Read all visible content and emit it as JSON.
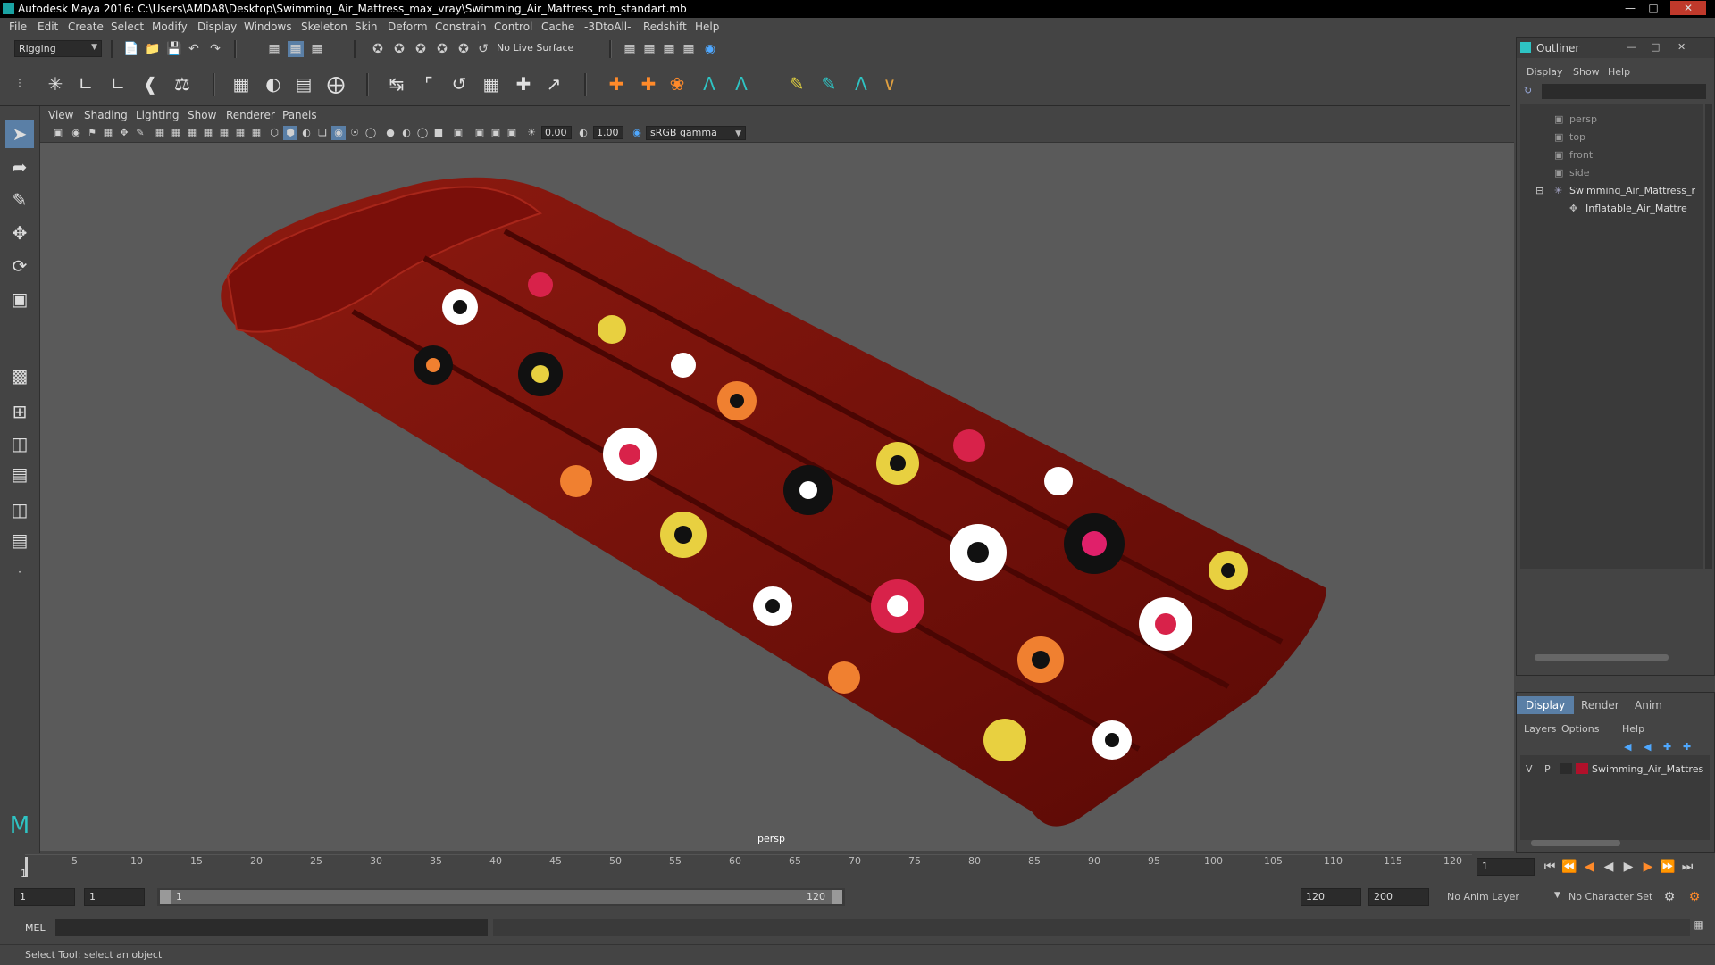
{
  "window": {
    "title": "Autodesk Maya 2016: C:\\Users\\AMDA8\\Desktop\\Swimming_Air_Mattress_max_vray\\Swimming_Air_Mattress_mb_standart.mb",
    "minimize_icon": "minimize-icon",
    "maximize_icon": "maximize-icon",
    "close_icon": "close-icon"
  },
  "menubar": {
    "items": [
      "File",
      "Edit",
      "Create",
      "Select",
      "Modify",
      "Display",
      "Windows",
      "Skeleton",
      "Skin",
      "Deform",
      "Constrain",
      "Control",
      "Cache",
      "-3DtoAll-",
      "Redshift",
      "Help"
    ]
  },
  "statusline": {
    "menuset": "Rigging",
    "live_surface": "No Live Surface"
  },
  "viewport": {
    "menu": [
      "View",
      "Shading",
      "Lighting",
      "Show",
      "Renderer",
      "Panels"
    ],
    "near_value": "0.00",
    "far_value": "1.00",
    "color_space": "sRGB gamma",
    "camera_label": "persp",
    "accent_color": "#2a6f9f",
    "mattress_color": "#7a0f0a"
  },
  "outliner": {
    "title": "Outliner",
    "menu": [
      "Display",
      "Show",
      "Help"
    ],
    "items": [
      {
        "label": "persp",
        "icon": "camera-icon"
      },
      {
        "label": "top",
        "icon": "camera-icon"
      },
      {
        "label": "front",
        "icon": "camera-icon"
      },
      {
        "label": "side",
        "icon": "camera-icon"
      },
      {
        "label": "Swimming_Air_Mattress_r",
        "icon": "group-icon"
      },
      {
        "label": "Inflatable_Air_Mattre",
        "icon": "mesh-icon"
      }
    ]
  },
  "layer_editor": {
    "tabs": [
      "Display",
      "Render",
      "Anim"
    ],
    "menu": [
      "Layers",
      "Options",
      "Help"
    ],
    "layer": {
      "v": "V",
      "p": "P",
      "name": "Swimming_Air_Mattres",
      "color": "#b0102a"
    }
  },
  "timeline": {
    "ticks": [
      "5",
      "10",
      "15",
      "20",
      "25",
      "30",
      "35",
      "40",
      "45",
      "50",
      "55",
      "60",
      "65",
      "70",
      "75",
      "80",
      "85",
      "90",
      "95",
      "100",
      "105",
      "110",
      "115",
      "120"
    ],
    "start_marker": "1",
    "current_frame": "1"
  },
  "range": {
    "start": "1",
    "playback_start": "1",
    "slider_start": "1",
    "slider_end": "120",
    "playback_end": "120",
    "end": "200",
    "anim_layer": "No Anim Layer",
    "character_set": "No Character Set"
  },
  "command": {
    "label": "MEL"
  },
  "helpline": {
    "text": "Select Tool: select an object"
  }
}
